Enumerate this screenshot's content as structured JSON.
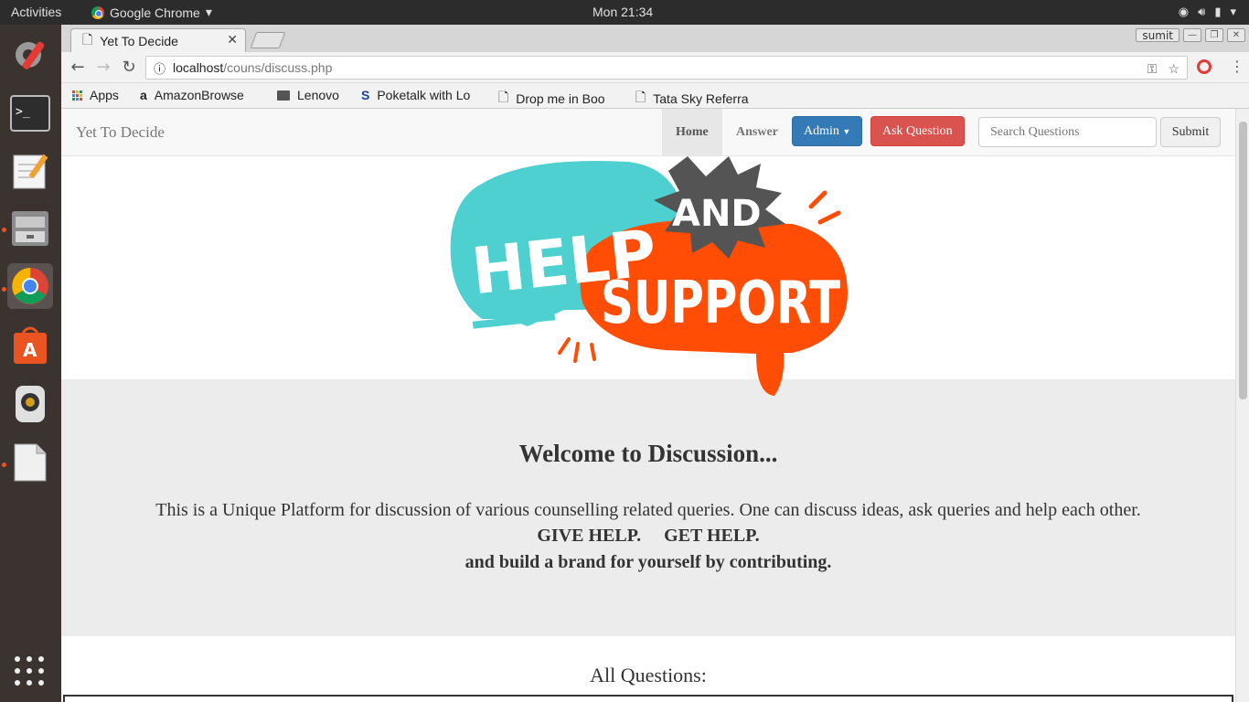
{
  "desktop": {
    "activities": "Activities",
    "app_menu": "Google Chrome",
    "clock": "Mon 21:34"
  },
  "dock": {
    "items": [
      "settings-icon",
      "terminal-icon",
      "text-editor-icon",
      "file-manager-icon",
      "chrome-icon",
      "software-center-icon",
      "audio-player-icon",
      "libreoffice-icon",
      "show-apps-icon"
    ]
  },
  "browser": {
    "tab_title": "Yet To Decide",
    "user_name": "sumit",
    "url_host": "localhost",
    "url_path": "/couns/discuss.php",
    "bookmarks": [
      "Apps",
      "AmazonBrowse",
      "Lenovo",
      "Poketalk with Lo",
      "Drop me in Boo",
      "Tata Sky Referra"
    ]
  },
  "site": {
    "brand": "Yet To Decide",
    "nav": {
      "home": "Home",
      "answer": "Answer",
      "admin": "Admin",
      "ask": "Ask Question",
      "search_placeholder": "Search Questions",
      "submit": "Submit"
    },
    "hero": {
      "help": "HELP",
      "and": "AND",
      "support": "SUPPORT"
    },
    "jumbotron": {
      "title": "Welcome to Discussion...",
      "text": "This is a Unique Platform for discussion of various counselling related queries. One can discuss ideas, ask queries and help each other.",
      "slogan": "GIVE HELP.     GET HELP.",
      "tagline": "and build a brand for yourself by contributing."
    },
    "all_questions": "All Questions:"
  },
  "colors": {
    "teal": "#4ecfd0",
    "orange": "#ff4d06",
    "dark": "#545454",
    "admin_blue": "#337ab7",
    "ask_red": "#d9534f",
    "jumbo_bg": "#ececec"
  }
}
